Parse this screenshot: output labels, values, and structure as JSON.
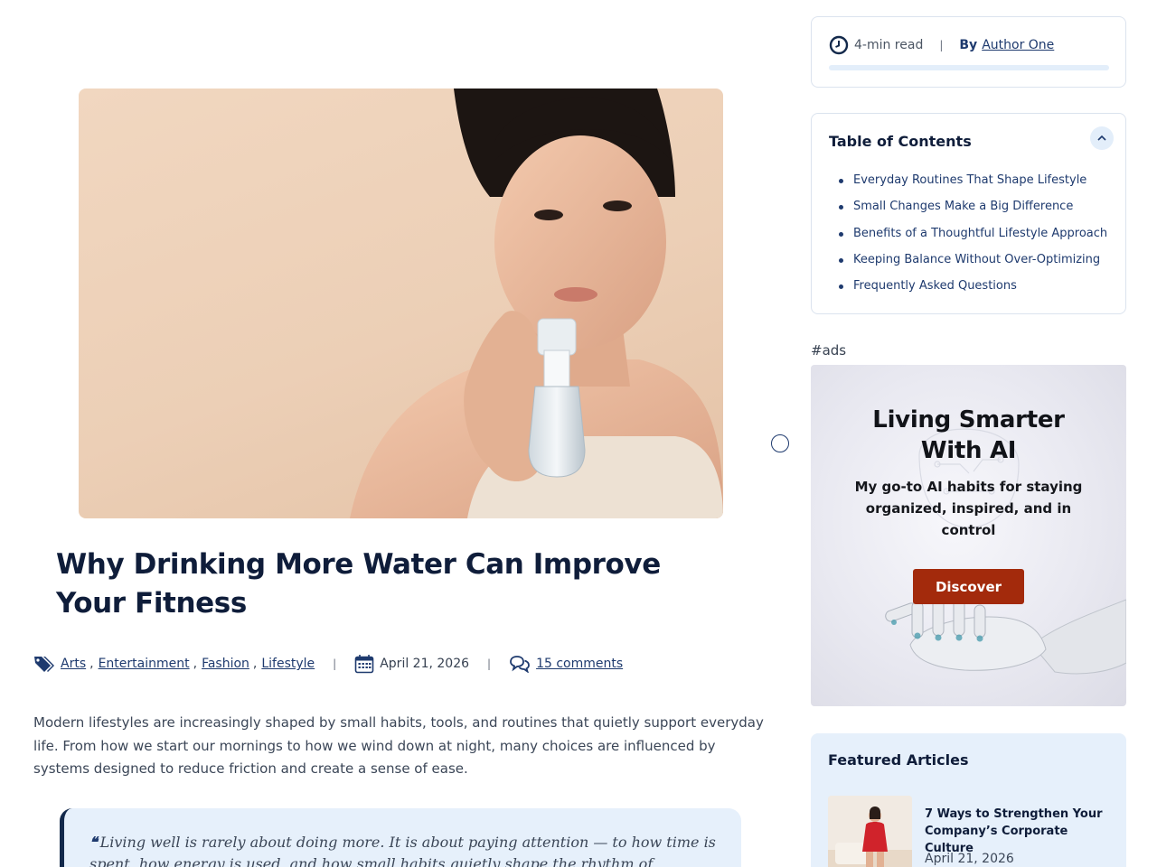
{
  "article": {
    "title": "Why Drinking More Water Can Improve Your Fitness",
    "hero_image": "woman-holding-water-bottle-photo",
    "categories": [
      "Arts",
      "Entertainment",
      "Fashion",
      "Lifestyle"
    ],
    "category_separator": ",",
    "meta_separator": "|",
    "date": "April 21, 2026",
    "comments_link": "15 comments",
    "intro": "Modern lifestyles are increasingly shaped by small habits, tools, and routines that quietly support everyday life. From how we start our mornings to how we wind down at night, many choices are influenced by systems designed to reduce friction and create a sense of ease.",
    "quote_mark": "❝",
    "quote": "Living well is rarely about doing more. It is about paying attention — to how time is spent, how energy is used, and how small habits quietly shape the rhythm of everyday life. Meaning often"
  },
  "reading": {
    "time": "4-min read",
    "separator": "|",
    "by_label": "By",
    "author": "Author One",
    "progress": 0.0
  },
  "toc": {
    "title": "Table of Contents",
    "items": [
      "Everyday Routines That Shape Lifestyle",
      "Small Changes Make a Big Difference",
      "Benefits of a Thoughtful Lifestyle Approach",
      "Keeping Balance Without Over-Optimizing",
      "Frequently Asked Questions"
    ]
  },
  "ads": {
    "label": "#ads",
    "title_line1": "Living Smarter",
    "title_line2": "With AI",
    "subtitle": "My go-to AI habits for staying organized, inspired, and in control",
    "button": "Discover"
  },
  "featured": {
    "title": "Featured Articles",
    "items": [
      {
        "title": "7 Ways to Strengthen Your Company’s Corporate Culture",
        "date": "April 21, 2026"
      }
    ]
  },
  "colors": {
    "navy": "#0f1d3a",
    "link": "#1e3a6e",
    "accent_bg": "#e6f0fb",
    "ad_button": "#a32a0c"
  }
}
